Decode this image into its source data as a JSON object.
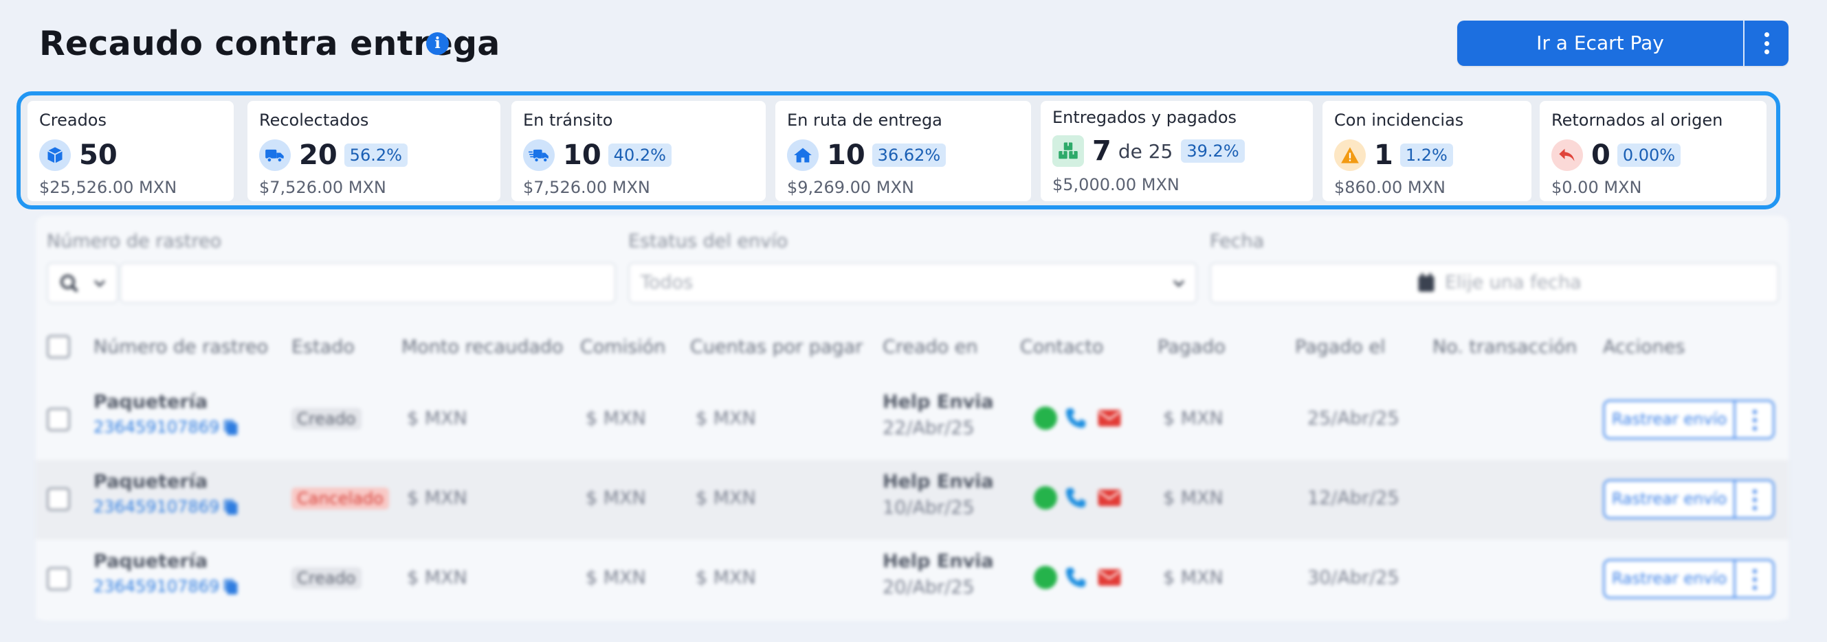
{
  "header": {
    "title": "Recaudo contra entrega",
    "info_icon": "info-icon",
    "primary_button": "Ir a Ecart Pay",
    "more_icon": "kebab-icon"
  },
  "colors": {
    "accent": "#1c6fe0",
    "highlight_border": "#2196f3",
    "badge_bg": "#d7e8fb",
    "badge_text": "#1a5fb4"
  },
  "stats": [
    {
      "label": "Creados",
      "count": "50",
      "amount": "$25,526.00 MXN",
      "icon": "box-icon",
      "icon_color": "#1a73e8",
      "icon_bg": "#cfe3fb"
    },
    {
      "label": "Recolectados",
      "count": "20",
      "percent": "56.2%",
      "amount": "$7,526.00 MXN",
      "icon": "truck-icon",
      "icon_color": "#1a73e8",
      "icon_bg": "#cfe3fb"
    },
    {
      "label": "En tránsito",
      "count": "10",
      "percent": "40.2%",
      "amount": "$7,526.00 MXN",
      "icon": "moving-truck-icon",
      "icon_color": "#1a73e8",
      "icon_bg": "#cfe3fb"
    },
    {
      "label": "En ruta de entrega",
      "count": "10",
      "percent": "36.62%",
      "amount": "$9,269.00 MXN",
      "icon": "home-icon",
      "icon_color": "#1a73e8",
      "icon_bg": "#cfe3fb"
    },
    {
      "label": "Entregados y pagados",
      "count": "7",
      "of_text": "de 25",
      "percent": "39.2%",
      "amount": "$5,000.00 MXN",
      "icon": "packages-icon",
      "icon_color": "#2eaa6a",
      "icon_bg": "#d3f0e1"
    },
    {
      "label": "Con incidencias",
      "count": "1",
      "percent": "1.2%",
      "amount": "$860.00 MXN",
      "icon": "warning-icon",
      "icon_color": "#f29a12",
      "icon_bg": "#fde7c4"
    },
    {
      "label": "Retornados al origen",
      "count": "0",
      "percent": "0.00%",
      "amount": "$0.00 MXN",
      "icon": "return-arrow-icon",
      "icon_color": "#e0443a",
      "icon_bg": "#fbd9d7"
    }
  ],
  "filters": {
    "tracking_label": "Número de rastreo",
    "status_label": "Estatus del envío",
    "status_value": "Todos",
    "date_label": "Fecha",
    "date_placeholder": "Elije una fecha"
  },
  "table": {
    "columns": [
      "Número de rastreo",
      "Estado",
      "Monto recaudado",
      "Comisión",
      "Cuentas por pagar",
      "Creado en",
      "Contacto",
      "Pagado",
      "Pagado el",
      "No. transacción",
      "Acciones"
    ],
    "rows": [
      {
        "carrier": "Paquetería",
        "tracking": "236459107869",
        "status": "Creado",
        "collected": "$   MXN",
        "commission": "$   MXN",
        "payable": "$   MXN",
        "created_by": "Help Envia",
        "created_date": "22/Abr/25",
        "paid": "$   MXN",
        "paid_date": "25/Abr/25",
        "action": "Rastrear envío"
      },
      {
        "carrier": "Paquetería",
        "tracking": "236459107869",
        "status": "Cancelado",
        "collected": "$   MXN",
        "commission": "$   MXN",
        "payable": "$   MXN",
        "created_by": "Help Envia",
        "created_date": "10/Abr/25",
        "paid": "$   MXN",
        "paid_date": "12/Abr/25",
        "action": "Rastrear envío"
      },
      {
        "carrier": "Paquetería",
        "tracking": "236459107869",
        "status": "Creado",
        "collected": "$   MXN",
        "commission": "$   MXN",
        "payable": "$   MXN",
        "created_by": "Help Envia",
        "created_date": "20/Abr/25",
        "paid": "$   MXN",
        "paid_date": "30/Abr/25",
        "action": "Rastrear envío"
      }
    ]
  }
}
